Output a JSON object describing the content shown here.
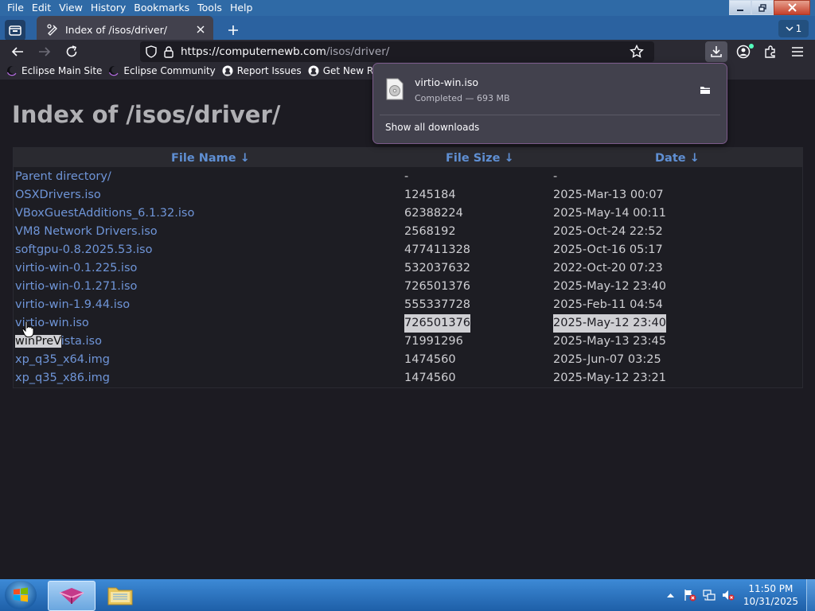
{
  "window": {
    "menu": [
      "File",
      "Edit",
      "View",
      "History",
      "Bookmarks",
      "Tools",
      "Help"
    ]
  },
  "tabs": {
    "active_title": "Index of /isos/driver/",
    "tab_count": "1"
  },
  "navbar": {
    "url_host": "https://computernewb.com",
    "url_path": "/isos/driver/"
  },
  "bookmarks": [
    {
      "label": "Eclipse Main Site",
      "icon": "eclipse-icon"
    },
    {
      "label": "Eclipse Community",
      "icon": "eclipse-icon"
    },
    {
      "label": "Report Issues",
      "icon": "github-icon"
    },
    {
      "label": "Get New Releases",
      "icon": "github-icon"
    }
  ],
  "page": {
    "title": "Index of /isos/driver/",
    "headers": {
      "name": "File Name  ↓",
      "size": "File Size  ↓",
      "date": "Date  ↓"
    },
    "rows": [
      {
        "name": "Parent directory/",
        "size": "-",
        "date": "-"
      },
      {
        "name": "OSXDrivers.iso",
        "size": "1245184",
        "date": "2025-Mar-13 00:07"
      },
      {
        "name": "VBoxGuestAdditions_6.1.32.iso",
        "size": "62388224",
        "date": "2025-May-14 00:11"
      },
      {
        "name": "VM8 Network Drivers.iso",
        "size": "2568192",
        "date": "2025-Oct-24 22:52"
      },
      {
        "name": "softgpu-0.8.2025.53.iso",
        "size": "477411328",
        "date": "2025-Oct-16 05:17"
      },
      {
        "name": "virtio-win-0.1.225.iso",
        "size": "532037632",
        "date": "2022-Oct-20 07:23"
      },
      {
        "name": "virtio-win-0.1.271.iso",
        "size": "726501376",
        "date": "2025-May-12 23:40"
      },
      {
        "name": "virtio-win-1.9.44.iso",
        "size": "555337728",
        "date": "2025-Feb-11 04:54"
      },
      {
        "name": "virtio-win.iso",
        "size": "726501376",
        "date": "2025-May-12 23:40"
      },
      {
        "name_selected": "winPreV",
        "name_rest": "ista.iso",
        "size": "71991296",
        "date": "2025-May-13 23:45"
      },
      {
        "name": "xp_q35_x64.img",
        "size": "1474560",
        "date": "2025-Jun-07 03:25"
      },
      {
        "name": "xp_q35_x86.img",
        "size": "1474560",
        "date": "2025-May-12 23:21"
      }
    ]
  },
  "downloads": {
    "file_name": "virtio-win.iso",
    "status": "Completed — 693 MB",
    "show_all": "Show all downloads"
  },
  "taskbar": {
    "time": "11:50 PM",
    "date": "10/31/2025"
  }
}
